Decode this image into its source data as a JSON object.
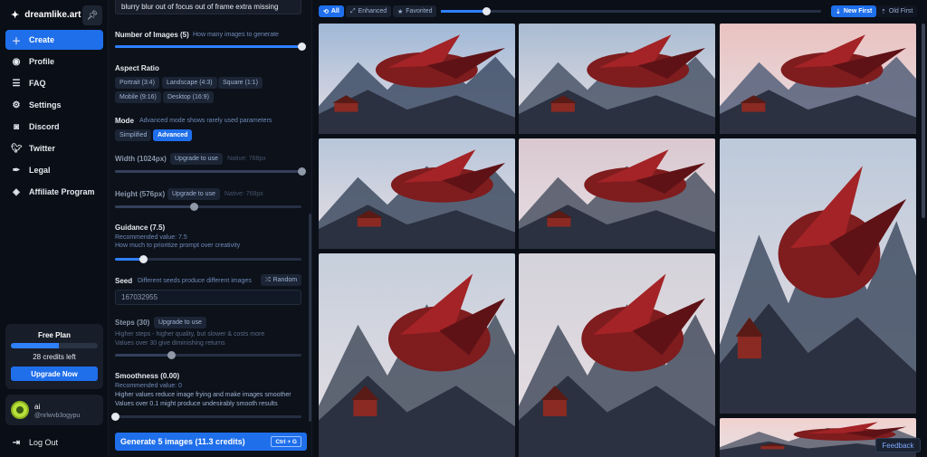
{
  "app": {
    "brand": "dreamlike.art",
    "brand_icon": "sparkle-icon"
  },
  "sidebar": {
    "items": [
      {
        "label": "Create",
        "icon": "plus-icon",
        "active": true
      },
      {
        "label": "Profile",
        "icon": "user-circle-icon"
      },
      {
        "label": "FAQ",
        "icon": "list-icon"
      },
      {
        "label": "Settings",
        "icon": "gear-icon"
      },
      {
        "label": "Discord",
        "icon": "discord-icon"
      },
      {
        "label": "Twitter",
        "icon": "twitter-icon"
      },
      {
        "label": "Legal",
        "icon": "feather-icon"
      },
      {
        "label": "Affiliate Program",
        "icon": "diamond-icon"
      }
    ],
    "plan": {
      "title": "Free Plan",
      "credits": "28 credits left",
      "credits_fraction": 0.55,
      "upgrade_label": "Upgrade Now"
    },
    "user": {
      "name": "ai",
      "handle": "@nrlwvb3ogypu"
    },
    "logout": "Log Out"
  },
  "settings": {
    "prompt": "blurry blur out of focus out of frame extra missing",
    "num_images": {
      "label": "Number of Images (5)",
      "hint": "How many images to generate",
      "value_fraction": 1.0
    },
    "aspect": {
      "label": "Aspect Ratio",
      "options": [
        "Portrait (3:4)",
        "Landscape (4:3)",
        "Square (1:1)",
        "Mobile (9:16)",
        "Desktop (16:9)"
      ]
    },
    "mode": {
      "label": "Mode",
      "hint": "Advanced mode shows rarely used parameters",
      "options": [
        "Simplified",
        "Advanced"
      ],
      "selected": "Advanced"
    },
    "width": {
      "label": "Width (1024px)",
      "upgrade": "Upgrade to use",
      "native": "Native: 768px",
      "value_fraction": 1.0
    },
    "height": {
      "label": "Height (576px)",
      "upgrade": "Upgrade to use",
      "native": "Native: 768px",
      "value_fraction": 0.42
    },
    "guidance": {
      "label": "Guidance (7.5)",
      "recommended": "Recommended value: 7.5",
      "desc": "How much to prioritize prompt over creativity",
      "value_fraction": 0.15
    },
    "seed": {
      "label": "Seed",
      "hint": "Different seeds produce different images",
      "random": "Random",
      "value": "167032955"
    },
    "steps": {
      "label": "Steps (30)",
      "upgrade": "Upgrade to use",
      "desc1": "Higher steps - higher quality, but slower & costs more",
      "desc2": "Values over 30 give diminishing returns",
      "value_fraction": 0.3
    },
    "smoothness": {
      "label": "Smoothness (0.00)",
      "recommended": "Recommended value: 0",
      "desc1": "Higher values reduce image frying and make images smoother",
      "desc2": "Values over 0.1 might produce undesirably smooth results",
      "value_fraction": 0.0
    },
    "generate": {
      "label": "Generate 5 images (11.3 credits)",
      "shortcut": "Ctrl + G"
    }
  },
  "gallery": {
    "filters": {
      "all": "All",
      "enhanced": "Enhanced",
      "favorited": "Favorited"
    },
    "size_fraction": 0.12,
    "sort": {
      "new_first": "New First",
      "old_first": "Old First"
    },
    "images": [
      {
        "sky": "#9fb8d6",
        "mtn": "#3e4e66"
      },
      {
        "sky": "#a9bcd2",
        "mtn": "#4a5668"
      },
      {
        "sky": "#e9c2c0",
        "mtn": "#55607a"
      },
      {
        "sky": "#b7c6da",
        "mtn": "#404c62"
      },
      {
        "sky": "#d9c8cf",
        "mtn": "#4c5364"
      },
      {
        "sky": "#bcc9da",
        "mtn": "#414d63"
      },
      {
        "sky": "#c6cfdc",
        "mtn": "#46505f"
      },
      {
        "sky": "#d4d2da",
        "mtn": "#454d5e"
      },
      {
        "sky": "#f0d2cf",
        "mtn": "#5a5f70"
      }
    ],
    "feedback": "Feedback"
  }
}
